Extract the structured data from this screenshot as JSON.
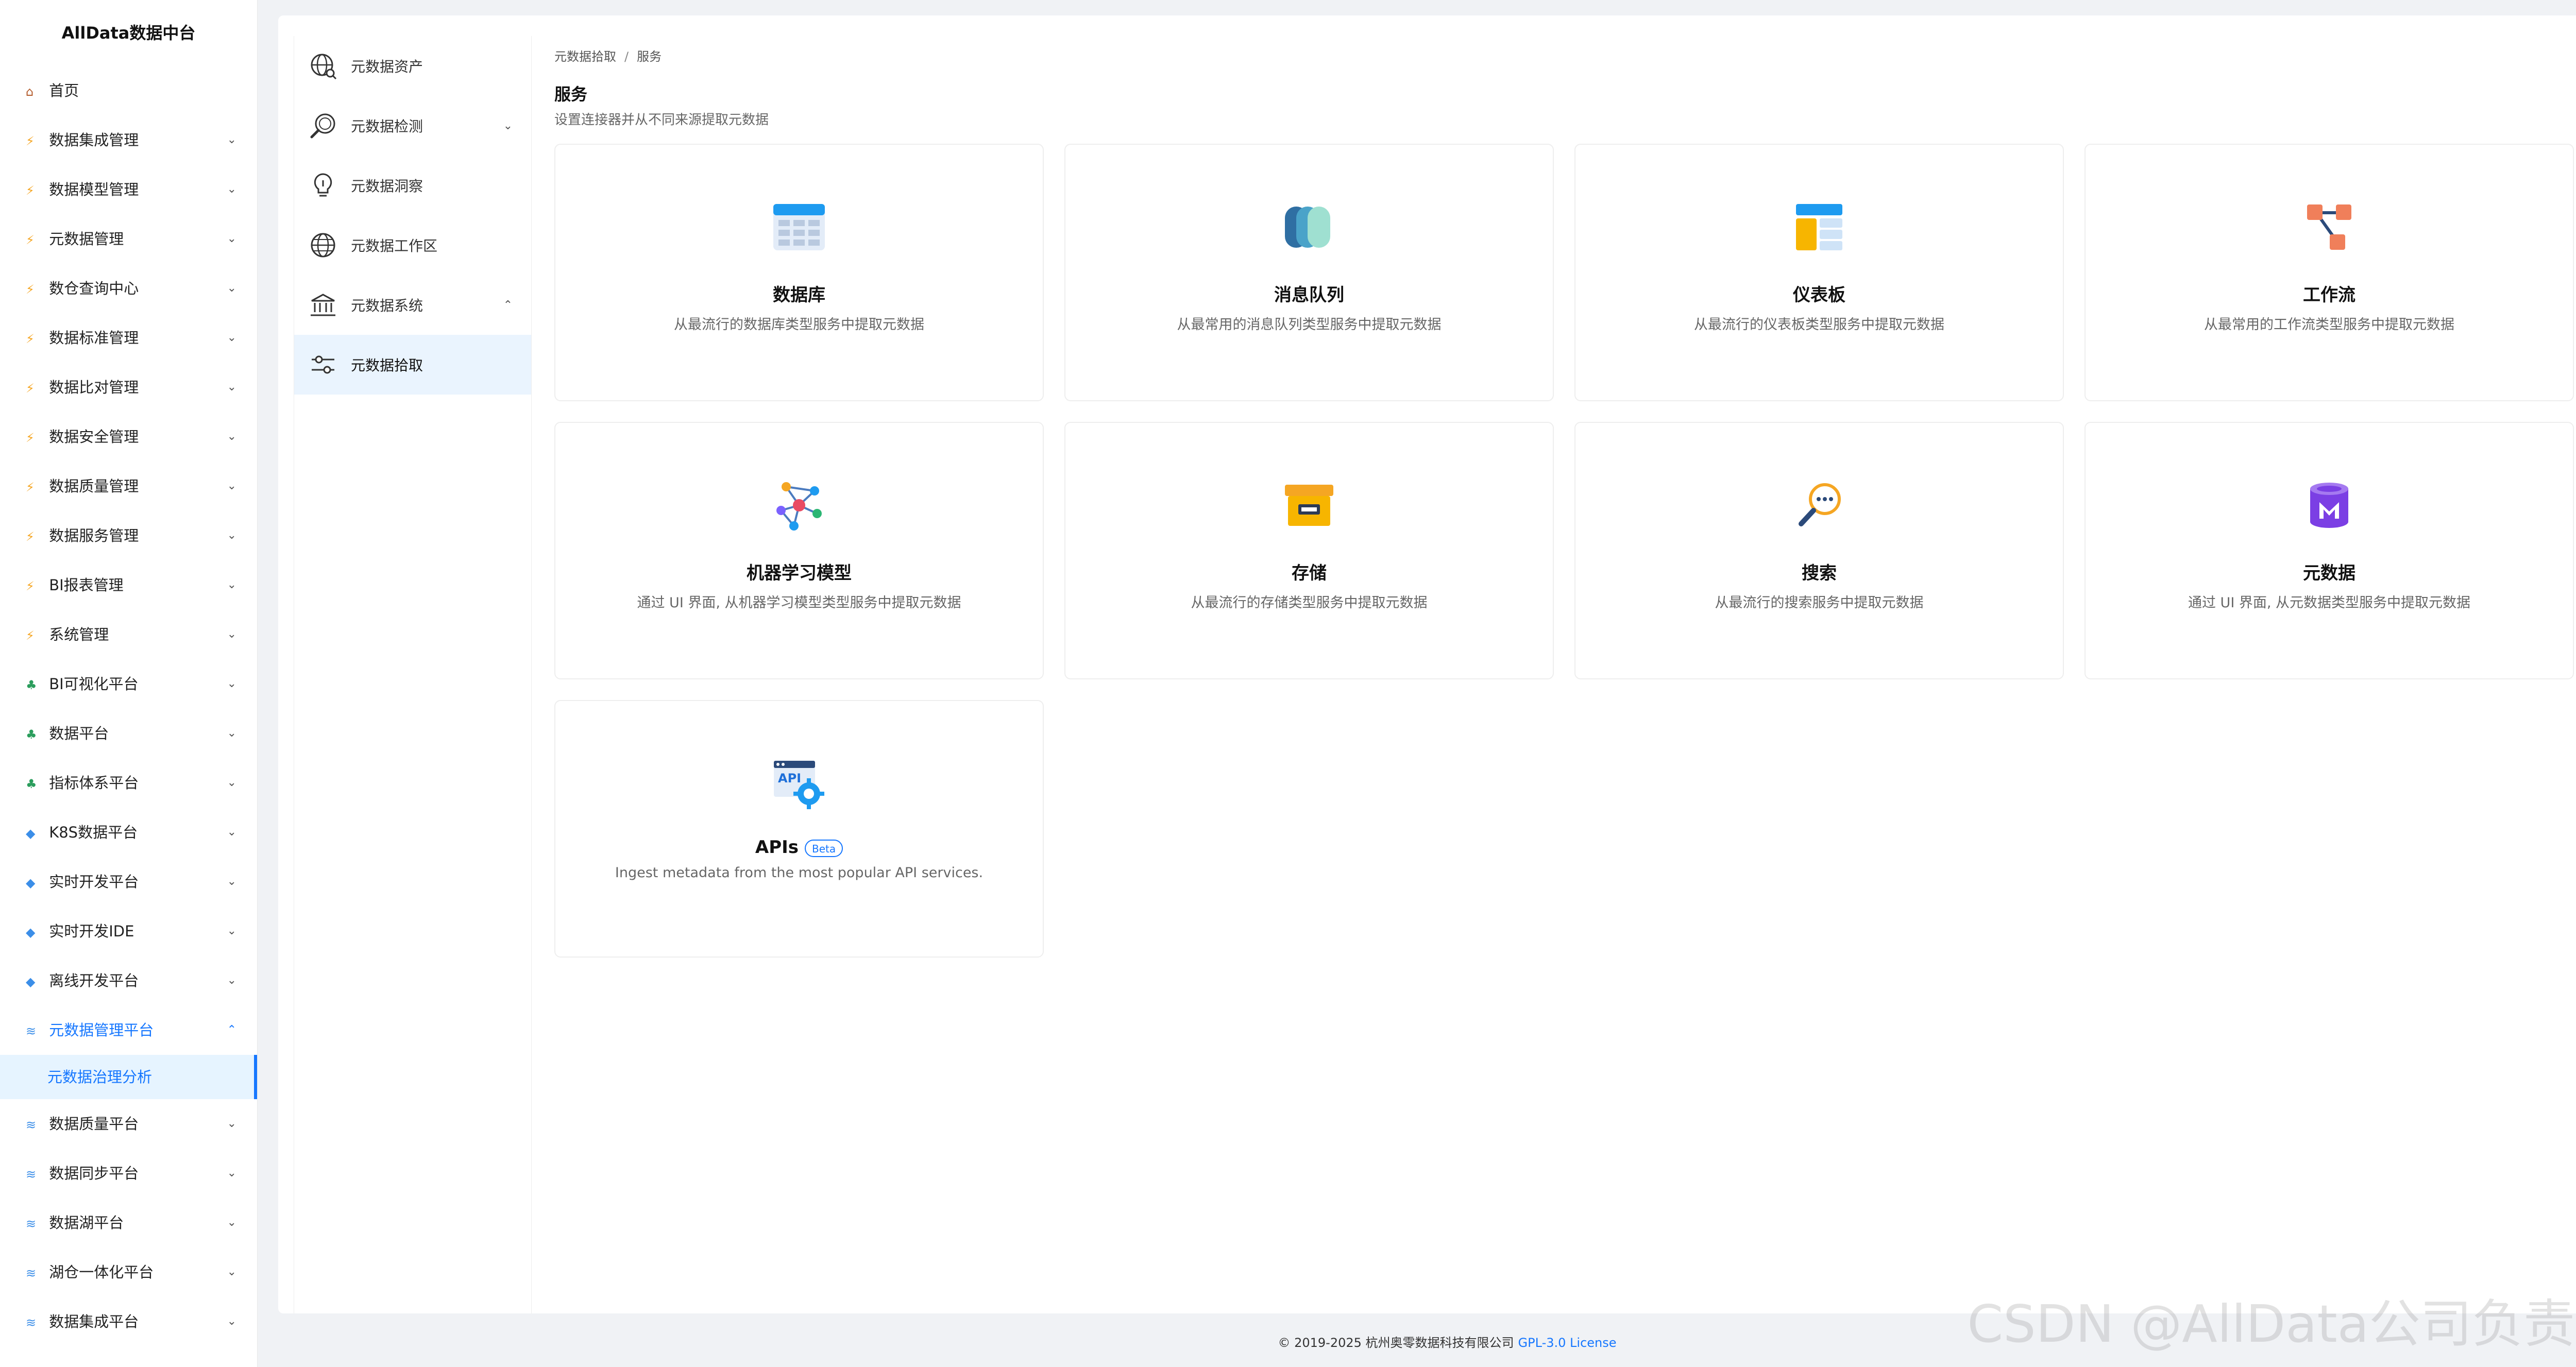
{
  "brand": "AllData数据中台",
  "sidebar": {
    "items": [
      {
        "label": "首页",
        "icon": "home-icon",
        "chevron": ""
      },
      {
        "label": "数据集成管理",
        "icon": "lightning-icon",
        "chevron": "⌄"
      },
      {
        "label": "数据模型管理",
        "icon": "lightning-icon",
        "chevron": "⌄"
      },
      {
        "label": "元数据管理",
        "icon": "lightning-icon",
        "chevron": "⌄"
      },
      {
        "label": "数仓查询中心",
        "icon": "lightning-icon",
        "chevron": "⌄"
      },
      {
        "label": "数据标准管理",
        "icon": "lightning-icon",
        "chevron": "⌄"
      },
      {
        "label": "数据比对管理",
        "icon": "lightning-icon",
        "chevron": "⌄"
      },
      {
        "label": "数据安全管理",
        "icon": "lightning-icon",
        "chevron": "⌄"
      },
      {
        "label": "数据质量管理",
        "icon": "lightning-icon",
        "chevron": "⌄"
      },
      {
        "label": "数据服务管理",
        "icon": "lightning-icon",
        "chevron": "⌄"
      },
      {
        "label": "BI报表管理",
        "icon": "lightning-icon",
        "chevron": "⌄"
      },
      {
        "label": "系统管理",
        "icon": "lightning-icon",
        "chevron": "⌄"
      },
      {
        "label": "BI可视化平台",
        "icon": "tree-icon",
        "chevron": "⌄"
      },
      {
        "label": "数据平台",
        "icon": "tree-icon",
        "chevron": "⌄"
      },
      {
        "label": "指标体系平台",
        "icon": "tree-icon",
        "chevron": "⌄"
      },
      {
        "label": "K8S数据平台",
        "icon": "gem-icon",
        "chevron": "⌄"
      },
      {
        "label": "实时开发平台",
        "icon": "gem-icon",
        "chevron": "⌄"
      },
      {
        "label": "实时开发IDE",
        "icon": "gem-icon",
        "chevron": "⌄"
      },
      {
        "label": "离线开发平台",
        "icon": "gem-icon",
        "chevron": "⌄"
      },
      {
        "label": "元数据管理平台",
        "icon": "stack-icon",
        "chevron": "⌃"
      },
      {
        "label": "数据质量平台",
        "icon": "stack-icon",
        "chevron": "⌄"
      },
      {
        "label": "数据同步平台",
        "icon": "stack-icon",
        "chevron": "⌄"
      },
      {
        "label": "数据湖平台",
        "icon": "stack-icon",
        "chevron": "⌄"
      },
      {
        "label": "湖仓一体化平台",
        "icon": "stack-icon",
        "chevron": "⌄"
      },
      {
        "label": "数据集成平台",
        "icon": "stack-icon",
        "chevron": "⌄"
      }
    ],
    "active_sub": "元数据治理分析"
  },
  "submenu": {
    "items": [
      {
        "label": "元数据资产",
        "icon": "globe-search-icon",
        "chevron": ""
      },
      {
        "label": "元数据检测",
        "icon": "magnifier-icon",
        "chevron": "⌄"
      },
      {
        "label": "元数据洞察",
        "icon": "lightbulb-icon",
        "chevron": ""
      },
      {
        "label": "元数据工作区",
        "icon": "globe-icon",
        "chevron": ""
      },
      {
        "label": "元数据系统",
        "icon": "bank-icon",
        "chevron": "⌃"
      },
      {
        "label": "元数据拾取",
        "icon": "sliders-icon",
        "chevron": ""
      }
    ]
  },
  "breadcrumb": {
    "parent": "元数据拾取",
    "separator": "/",
    "current": "服务"
  },
  "page": {
    "title": "服务",
    "subtitle": "设置连接器并从不同来源提取元数据"
  },
  "cards": [
    {
      "title": "数据库",
      "desc": "从最流行的数据库类型服务中提取元数据",
      "icon": "database-table-icon"
    },
    {
      "title": "消息队列",
      "desc": "从最常用的消息队列类型服务中提取元数据",
      "icon": "message-queue-icon"
    },
    {
      "title": "仪表板",
      "desc": "从最流行的仪表板类型服务中提取元数据",
      "icon": "dashboard-icon"
    },
    {
      "title": "工作流",
      "desc": "从最常用的工作流类型服务中提取元数据",
      "icon": "workflow-icon"
    },
    {
      "title": "机器学习模型",
      "desc": "通过 UI 界面, 从机器学习模型类型服务中提取元数据",
      "icon": "ml-model-icon"
    },
    {
      "title": "存储",
      "desc": "从最流行的存储类型服务中提取元数据",
      "icon": "storage-box-icon"
    },
    {
      "title": "搜索",
      "desc": "从最流行的搜索服务中提取元数据",
      "icon": "search-service-icon"
    },
    {
      "title": "元数据",
      "desc": "通过 UI 界面, 从元数据类型服务中提取元数据",
      "icon": "metadata-cylinder-icon"
    },
    {
      "title": "APIs",
      "desc": "Ingest metadata from the most popular API services.",
      "icon": "api-gear-icon",
      "badge": "Beta"
    }
  ],
  "footer": {
    "copyright": "© 2019-2025 杭州奥零数据科技有限公司",
    "license": "GPL-3.0 License"
  },
  "watermark": "CSDN @AllData公司负责人",
  "colors": {
    "accent": "#1677ff",
    "active_bg": "#e6f4ff",
    "page_bg": "#f0f2f5"
  }
}
